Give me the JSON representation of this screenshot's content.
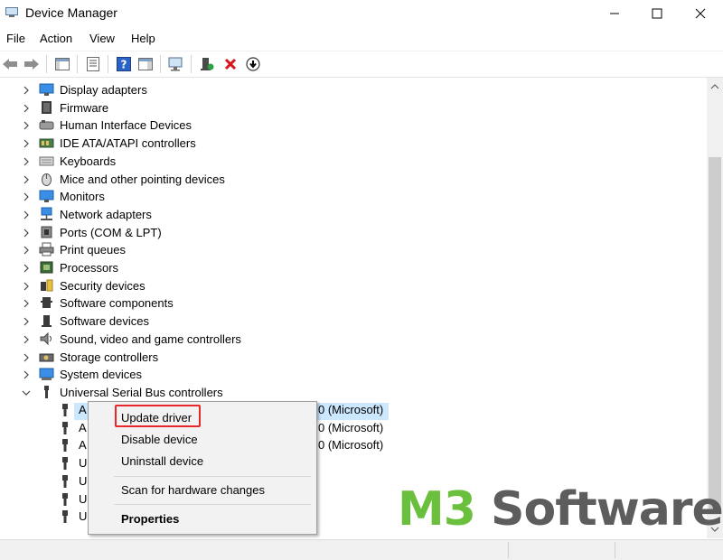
{
  "window": {
    "title": "Device Manager",
    "icons": {
      "app": "device-manager-icon",
      "minimize": "minimize-icon",
      "maximize": "maximize-icon",
      "close": "close-icon"
    }
  },
  "menubar": {
    "items": [
      {
        "label": "File"
      },
      {
        "label": "Action"
      },
      {
        "label": "View"
      },
      {
        "label": "Help"
      }
    ]
  },
  "toolbar": {
    "buttons": [
      "back-icon",
      "forward-icon",
      "show-hide-console-tree-icon",
      "properties-icon",
      "help-icon",
      "show-action-pane-icon",
      "scan-hardware-icon",
      "update-driver-icon",
      "uninstall-device-icon",
      "disable-device-icon"
    ]
  },
  "tree": {
    "categories": [
      {
        "label": "Display adapters",
        "icon": "display-adapter-icon"
      },
      {
        "label": "Firmware",
        "icon": "firmware-icon"
      },
      {
        "label": "Human Interface Devices",
        "icon": "hid-icon"
      },
      {
        "label": "IDE ATA/ATAPI controllers",
        "icon": "ide-controller-icon"
      },
      {
        "label": "Keyboards",
        "icon": "keyboard-icon"
      },
      {
        "label": "Mice and other pointing devices",
        "icon": "mouse-icon"
      },
      {
        "label": "Monitors",
        "icon": "monitor-icon"
      },
      {
        "label": "Network adapters",
        "icon": "network-adapter-icon"
      },
      {
        "label": "Ports (COM & LPT)",
        "icon": "port-icon"
      },
      {
        "label": "Print queues",
        "icon": "printer-icon"
      },
      {
        "label": "Processors",
        "icon": "processor-icon"
      },
      {
        "label": "Security devices",
        "icon": "security-device-icon"
      },
      {
        "label": "Software components",
        "icon": "software-component-icon"
      },
      {
        "label": "Software devices",
        "icon": "software-device-icon"
      },
      {
        "label": "Sound, video and game controllers",
        "icon": "sound-icon"
      },
      {
        "label": "Storage controllers",
        "icon": "storage-controller-icon"
      },
      {
        "label": "System devices",
        "icon": "system-device-icon"
      },
      {
        "label": "Universal Serial Bus controllers",
        "icon": "usb-icon",
        "expanded": true
      }
    ],
    "usb_children": [
      {
        "prefix": "A",
        "suffix": "0 (Microsoft)",
        "selected": true
      },
      {
        "prefix": "A",
        "suffix": "0 (Microsoft)"
      },
      {
        "prefix": "A",
        "suffix": "0 (Microsoft)"
      },
      {
        "prefix": "U",
        "suffix": ""
      },
      {
        "prefix": "U",
        "suffix": ""
      },
      {
        "prefix": "U",
        "suffix": ""
      },
      {
        "prefix": "U",
        "suffix": ""
      }
    ]
  },
  "context_menu": {
    "items": [
      {
        "label": "Update driver",
        "highlighted": true
      },
      {
        "label": "Disable device"
      },
      {
        "label": "Uninstall device"
      },
      {
        "label": "Scan for hardware changes"
      },
      {
        "label": "Properties",
        "bold": true
      }
    ]
  },
  "watermark": {
    "part1": "M3",
    "part2": " Software",
    "color1": "#6abf3c",
    "color2": "#5d5d5d"
  },
  "colors": {
    "highlight_border": "#e8272a",
    "selection": "#cce8ff",
    "close_red": "#d4151b"
  }
}
